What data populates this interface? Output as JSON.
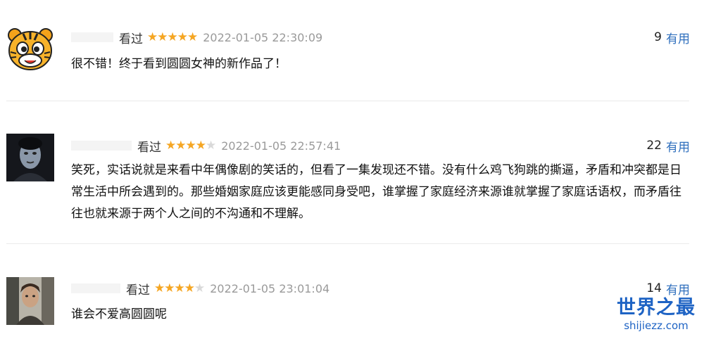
{
  "reviews": [
    {
      "status": "看过",
      "rating": 5,
      "time": "2022-01-05 22:30:09",
      "useful_count": "9",
      "useful_label": "有用",
      "text": "很不错！终于看到圆圆女神的新作品了！",
      "avatar": "tiger-cartoon"
    },
    {
      "status": "看过",
      "rating": 4,
      "time": "2022-01-05 22:57:41",
      "useful_count": "22",
      "useful_label": "有用",
      "text": "笑死，实话说就是来看中年偶像剧的笑话的，但看了一集发现还不错。没有什么鸡飞狗跳的撕逼，矛盾和冲突都是日常生活中所会遇到的。那些婚姻家庭应该更能感同身受吧，谁掌握了家庭经济来源谁就掌握了家庭话语权，而矛盾往往也就来源于两个人之间的不沟通和不理解。",
      "avatar": "dark-portrait"
    },
    {
      "status": "看过",
      "rating": 4,
      "time": "2022-01-05 23:01:04",
      "useful_count": "14",
      "useful_label": "有用",
      "text": "谁会不爱高圆圆呢",
      "avatar": "photo-portrait"
    }
  ],
  "watermark": {
    "title": "世界之最",
    "domain": "shijiezz.com"
  },
  "colors": {
    "star": "#f5a623",
    "link": "#2f6fbd",
    "watermark": "#1e63c4"
  }
}
